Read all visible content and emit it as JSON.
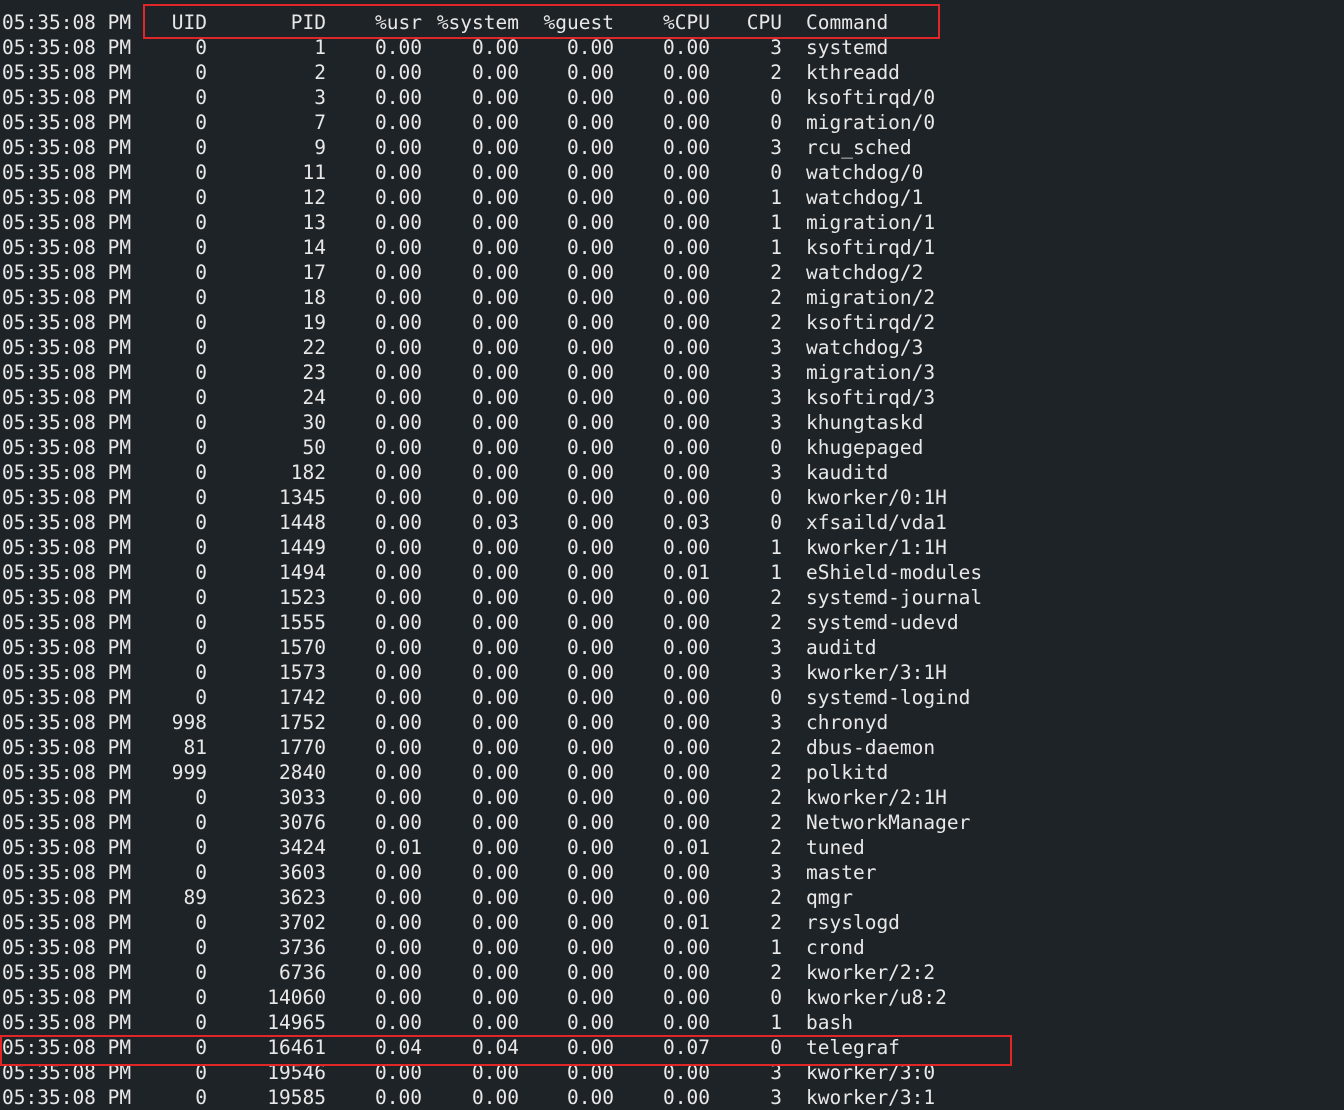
{
  "header": {
    "time": "05:35:08 PM",
    "uid": "UID",
    "pid": "PID",
    "usr": "%usr",
    "system": "%system",
    "guest": "%guest",
    "cpu_pct": "%CPU",
    "cpu": "CPU",
    "command": "Command"
  },
  "highlight_color": "#e02626",
  "rows": [
    {
      "time": "05:35:08 PM",
      "uid": "0",
      "pid": "1",
      "usr": "0.00",
      "system": "0.00",
      "guest": "0.00",
      "cpu_pct": "0.00",
      "cpu": "3",
      "command": "systemd"
    },
    {
      "time": "05:35:08 PM",
      "uid": "0",
      "pid": "2",
      "usr": "0.00",
      "system": "0.00",
      "guest": "0.00",
      "cpu_pct": "0.00",
      "cpu": "2",
      "command": "kthreadd"
    },
    {
      "time": "05:35:08 PM",
      "uid": "0",
      "pid": "3",
      "usr": "0.00",
      "system": "0.00",
      "guest": "0.00",
      "cpu_pct": "0.00",
      "cpu": "0",
      "command": "ksoftirqd/0"
    },
    {
      "time": "05:35:08 PM",
      "uid": "0",
      "pid": "7",
      "usr": "0.00",
      "system": "0.00",
      "guest": "0.00",
      "cpu_pct": "0.00",
      "cpu": "0",
      "command": "migration/0"
    },
    {
      "time": "05:35:08 PM",
      "uid": "0",
      "pid": "9",
      "usr": "0.00",
      "system": "0.00",
      "guest": "0.00",
      "cpu_pct": "0.00",
      "cpu": "3",
      "command": "rcu_sched"
    },
    {
      "time": "05:35:08 PM",
      "uid": "0",
      "pid": "11",
      "usr": "0.00",
      "system": "0.00",
      "guest": "0.00",
      "cpu_pct": "0.00",
      "cpu": "0",
      "command": "watchdog/0"
    },
    {
      "time": "05:35:08 PM",
      "uid": "0",
      "pid": "12",
      "usr": "0.00",
      "system": "0.00",
      "guest": "0.00",
      "cpu_pct": "0.00",
      "cpu": "1",
      "command": "watchdog/1"
    },
    {
      "time": "05:35:08 PM",
      "uid": "0",
      "pid": "13",
      "usr": "0.00",
      "system": "0.00",
      "guest": "0.00",
      "cpu_pct": "0.00",
      "cpu": "1",
      "command": "migration/1"
    },
    {
      "time": "05:35:08 PM",
      "uid": "0",
      "pid": "14",
      "usr": "0.00",
      "system": "0.00",
      "guest": "0.00",
      "cpu_pct": "0.00",
      "cpu": "1",
      "command": "ksoftirqd/1"
    },
    {
      "time": "05:35:08 PM",
      "uid": "0",
      "pid": "17",
      "usr": "0.00",
      "system": "0.00",
      "guest": "0.00",
      "cpu_pct": "0.00",
      "cpu": "2",
      "command": "watchdog/2"
    },
    {
      "time": "05:35:08 PM",
      "uid": "0",
      "pid": "18",
      "usr": "0.00",
      "system": "0.00",
      "guest": "0.00",
      "cpu_pct": "0.00",
      "cpu": "2",
      "command": "migration/2"
    },
    {
      "time": "05:35:08 PM",
      "uid": "0",
      "pid": "19",
      "usr": "0.00",
      "system": "0.00",
      "guest": "0.00",
      "cpu_pct": "0.00",
      "cpu": "2",
      "command": "ksoftirqd/2"
    },
    {
      "time": "05:35:08 PM",
      "uid": "0",
      "pid": "22",
      "usr": "0.00",
      "system": "0.00",
      "guest": "0.00",
      "cpu_pct": "0.00",
      "cpu": "3",
      "command": "watchdog/3"
    },
    {
      "time": "05:35:08 PM",
      "uid": "0",
      "pid": "23",
      "usr": "0.00",
      "system": "0.00",
      "guest": "0.00",
      "cpu_pct": "0.00",
      "cpu": "3",
      "command": "migration/3"
    },
    {
      "time": "05:35:08 PM",
      "uid": "0",
      "pid": "24",
      "usr": "0.00",
      "system": "0.00",
      "guest": "0.00",
      "cpu_pct": "0.00",
      "cpu": "3",
      "command": "ksoftirqd/3"
    },
    {
      "time": "05:35:08 PM",
      "uid": "0",
      "pid": "30",
      "usr": "0.00",
      "system": "0.00",
      "guest": "0.00",
      "cpu_pct": "0.00",
      "cpu": "3",
      "command": "khungtaskd"
    },
    {
      "time": "05:35:08 PM",
      "uid": "0",
      "pid": "50",
      "usr": "0.00",
      "system": "0.00",
      "guest": "0.00",
      "cpu_pct": "0.00",
      "cpu": "0",
      "command": "khugepaged"
    },
    {
      "time": "05:35:08 PM",
      "uid": "0",
      "pid": "182",
      "usr": "0.00",
      "system": "0.00",
      "guest": "0.00",
      "cpu_pct": "0.00",
      "cpu": "3",
      "command": "kauditd"
    },
    {
      "time": "05:35:08 PM",
      "uid": "0",
      "pid": "1345",
      "usr": "0.00",
      "system": "0.00",
      "guest": "0.00",
      "cpu_pct": "0.00",
      "cpu": "0",
      "command": "kworker/0:1H"
    },
    {
      "time": "05:35:08 PM",
      "uid": "0",
      "pid": "1448",
      "usr": "0.00",
      "system": "0.03",
      "guest": "0.00",
      "cpu_pct": "0.03",
      "cpu": "0",
      "command": "xfsaild/vda1"
    },
    {
      "time": "05:35:08 PM",
      "uid": "0",
      "pid": "1449",
      "usr": "0.00",
      "system": "0.00",
      "guest": "0.00",
      "cpu_pct": "0.00",
      "cpu": "1",
      "command": "kworker/1:1H"
    },
    {
      "time": "05:35:08 PM",
      "uid": "0",
      "pid": "1494",
      "usr": "0.00",
      "system": "0.00",
      "guest": "0.00",
      "cpu_pct": "0.01",
      "cpu": "1",
      "command": "eShield-modules"
    },
    {
      "time": "05:35:08 PM",
      "uid": "0",
      "pid": "1523",
      "usr": "0.00",
      "system": "0.00",
      "guest": "0.00",
      "cpu_pct": "0.00",
      "cpu": "2",
      "command": "systemd-journal"
    },
    {
      "time": "05:35:08 PM",
      "uid": "0",
      "pid": "1555",
      "usr": "0.00",
      "system": "0.00",
      "guest": "0.00",
      "cpu_pct": "0.00",
      "cpu": "2",
      "command": "systemd-udevd"
    },
    {
      "time": "05:35:08 PM",
      "uid": "0",
      "pid": "1570",
      "usr": "0.00",
      "system": "0.00",
      "guest": "0.00",
      "cpu_pct": "0.00",
      "cpu": "3",
      "command": "auditd"
    },
    {
      "time": "05:35:08 PM",
      "uid": "0",
      "pid": "1573",
      "usr": "0.00",
      "system": "0.00",
      "guest": "0.00",
      "cpu_pct": "0.00",
      "cpu": "3",
      "command": "kworker/3:1H"
    },
    {
      "time": "05:35:08 PM",
      "uid": "0",
      "pid": "1742",
      "usr": "0.00",
      "system": "0.00",
      "guest": "0.00",
      "cpu_pct": "0.00",
      "cpu": "0",
      "command": "systemd-logind"
    },
    {
      "time": "05:35:08 PM",
      "uid": "998",
      "pid": "1752",
      "usr": "0.00",
      "system": "0.00",
      "guest": "0.00",
      "cpu_pct": "0.00",
      "cpu": "3",
      "command": "chronyd"
    },
    {
      "time": "05:35:08 PM",
      "uid": "81",
      "pid": "1770",
      "usr": "0.00",
      "system": "0.00",
      "guest": "0.00",
      "cpu_pct": "0.00",
      "cpu": "2",
      "command": "dbus-daemon"
    },
    {
      "time": "05:35:08 PM",
      "uid": "999",
      "pid": "2840",
      "usr": "0.00",
      "system": "0.00",
      "guest": "0.00",
      "cpu_pct": "0.00",
      "cpu": "2",
      "command": "polkitd"
    },
    {
      "time": "05:35:08 PM",
      "uid": "0",
      "pid": "3033",
      "usr": "0.00",
      "system": "0.00",
      "guest": "0.00",
      "cpu_pct": "0.00",
      "cpu": "2",
      "command": "kworker/2:1H"
    },
    {
      "time": "05:35:08 PM",
      "uid": "0",
      "pid": "3076",
      "usr": "0.00",
      "system": "0.00",
      "guest": "0.00",
      "cpu_pct": "0.00",
      "cpu": "2",
      "command": "NetworkManager"
    },
    {
      "time": "05:35:08 PM",
      "uid": "0",
      "pid": "3424",
      "usr": "0.01",
      "system": "0.00",
      "guest": "0.00",
      "cpu_pct": "0.01",
      "cpu": "2",
      "command": "tuned"
    },
    {
      "time": "05:35:08 PM",
      "uid": "0",
      "pid": "3603",
      "usr": "0.00",
      "system": "0.00",
      "guest": "0.00",
      "cpu_pct": "0.00",
      "cpu": "3",
      "command": "master"
    },
    {
      "time": "05:35:08 PM",
      "uid": "89",
      "pid": "3623",
      "usr": "0.00",
      "system": "0.00",
      "guest": "0.00",
      "cpu_pct": "0.00",
      "cpu": "2",
      "command": "qmgr"
    },
    {
      "time": "05:35:08 PM",
      "uid": "0",
      "pid": "3702",
      "usr": "0.00",
      "system": "0.00",
      "guest": "0.00",
      "cpu_pct": "0.01",
      "cpu": "2",
      "command": "rsyslogd"
    },
    {
      "time": "05:35:08 PM",
      "uid": "0",
      "pid": "3736",
      "usr": "0.00",
      "system": "0.00",
      "guest": "0.00",
      "cpu_pct": "0.00",
      "cpu": "1",
      "command": "crond"
    },
    {
      "time": "05:35:08 PM",
      "uid": "0",
      "pid": "6736",
      "usr": "0.00",
      "system": "0.00",
      "guest": "0.00",
      "cpu_pct": "0.00",
      "cpu": "2",
      "command": "kworker/2:2"
    },
    {
      "time": "05:35:08 PM",
      "uid": "0",
      "pid": "14060",
      "usr": "0.00",
      "system": "0.00",
      "guest": "0.00",
      "cpu_pct": "0.00",
      "cpu": "0",
      "command": "kworker/u8:2"
    },
    {
      "time": "05:35:08 PM",
      "uid": "0",
      "pid": "14965",
      "usr": "0.00",
      "system": "0.00",
      "guest": "0.00",
      "cpu_pct": "0.00",
      "cpu": "1",
      "command": "bash"
    },
    {
      "time": "05:35:08 PM",
      "uid": "0",
      "pid": "16461",
      "usr": "0.04",
      "system": "0.04",
      "guest": "0.00",
      "cpu_pct": "0.07",
      "cpu": "0",
      "command": "telegraf"
    },
    {
      "time": "05:35:08 PM",
      "uid": "0",
      "pid": "19546",
      "usr": "0.00",
      "system": "0.00",
      "guest": "0.00",
      "cpu_pct": "0.00",
      "cpu": "3",
      "command": "kworker/3:0"
    },
    {
      "time": "05:35:08 PM",
      "uid": "0",
      "pid": "19585",
      "usr": "0.00",
      "system": "0.00",
      "guest": "0.00",
      "cpu_pct": "0.00",
      "cpu": "3",
      "command": "kworker/3:1"
    }
  ]
}
